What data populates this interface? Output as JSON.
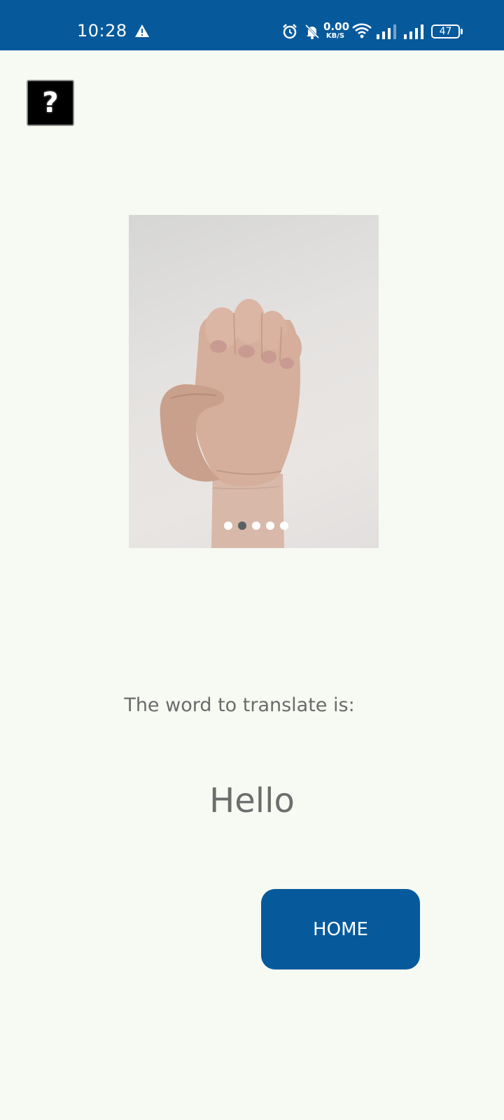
{
  "status_bar": {
    "time": "10:28",
    "net_speed_value": "0.00",
    "net_speed_unit": "KB/S",
    "battery_level": "47",
    "icons": [
      "warning-icon",
      "alarm-icon",
      "bell-off-icon",
      "wifi-icon",
      "signal-icon",
      "signal-icon",
      "battery-icon"
    ]
  },
  "help_button": {
    "label": "?"
  },
  "carousel": {
    "image": "hand-sign-image",
    "dot_count": 5,
    "active_index": 1
  },
  "prompt": {
    "label": "The word to translate is:",
    "word": "Hello"
  },
  "home_button": {
    "label": "HOME"
  },
  "colors": {
    "primary": "#065a9c",
    "background": "#f7faf3",
    "text_muted": "#6b6b6b"
  }
}
